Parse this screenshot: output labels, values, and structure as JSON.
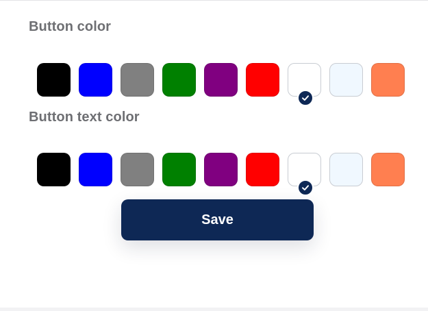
{
  "button_color": {
    "label": "Button color",
    "selected_index": 6,
    "swatches": [
      {
        "name": "black",
        "color": "#000000"
      },
      {
        "name": "blue",
        "color": "#0000ff"
      },
      {
        "name": "gray",
        "color": "#808080"
      },
      {
        "name": "green",
        "color": "#008000"
      },
      {
        "name": "purple",
        "color": "#800080"
      },
      {
        "name": "red",
        "color": "#ff0000"
      },
      {
        "name": "white",
        "color": "#ffffff"
      },
      {
        "name": "alice-blue",
        "color": "#f0f8ff"
      },
      {
        "name": "coral",
        "color": "#ff7f50"
      }
    ]
  },
  "button_text_color": {
    "label": "Button text color",
    "selected_index": 6,
    "swatches": [
      {
        "name": "black",
        "color": "#000000"
      },
      {
        "name": "blue",
        "color": "#0000ff"
      },
      {
        "name": "gray",
        "color": "#808080"
      },
      {
        "name": "green",
        "color": "#008000"
      },
      {
        "name": "purple",
        "color": "#800080"
      },
      {
        "name": "red",
        "color": "#ff0000"
      },
      {
        "name": "white",
        "color": "#ffffff"
      },
      {
        "name": "alice-blue",
        "color": "#f0f8ff"
      },
      {
        "name": "coral",
        "color": "#ff7f50"
      }
    ]
  },
  "save_button": {
    "label": "Save",
    "background": "#0e2855",
    "text_color": "#ffffff"
  },
  "icons": {
    "selected_check": "checkmark-icon"
  }
}
